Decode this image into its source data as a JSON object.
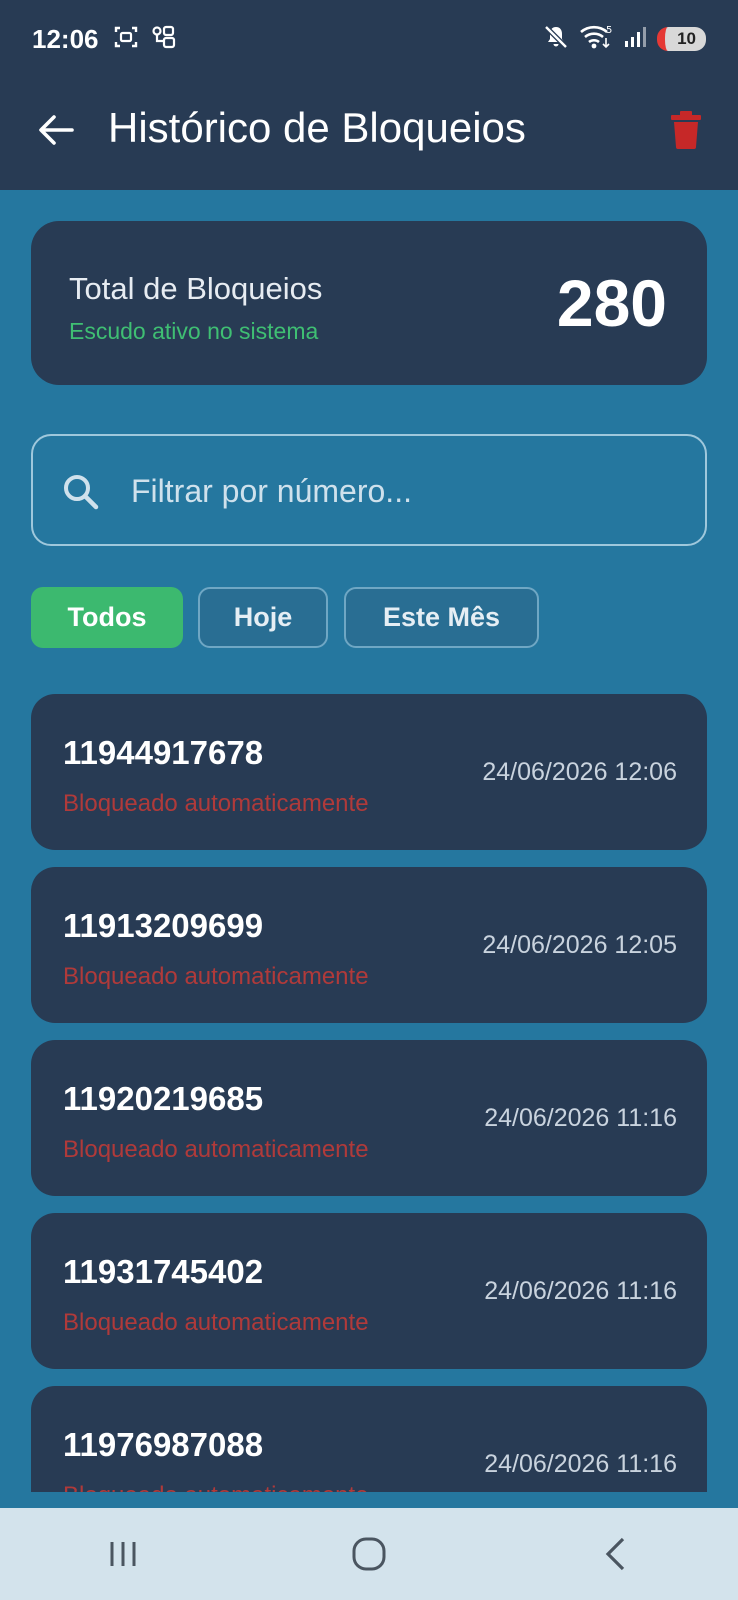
{
  "status_bar": {
    "time": "12:06",
    "battery": "10",
    "icons": [
      "screenshot-icon",
      "cast-icon",
      "mute-icon",
      "wifi-icon",
      "signal-icon",
      "battery-icon"
    ]
  },
  "app_bar": {
    "title": "Histórico de Bloqueios"
  },
  "summary": {
    "title": "Total de Bloqueios",
    "subtitle": "Escudo ativo no sistema",
    "count": "280"
  },
  "search": {
    "placeholder": "Filtrar por número..."
  },
  "filters": [
    {
      "label": "Todos",
      "active": true
    },
    {
      "label": "Hoje",
      "active": false
    },
    {
      "label": "Este Mês",
      "active": false
    }
  ],
  "blocks": [
    {
      "number": "11944917678",
      "status": "Bloqueado automaticamente",
      "time": "24/06/2026 12:06"
    },
    {
      "number": "11913209699",
      "status": "Bloqueado automaticamente",
      "time": "24/06/2026 12:05"
    },
    {
      "number": "11920219685",
      "status": "Bloqueado automaticamente",
      "time": "24/06/2026 11:16"
    },
    {
      "number": "11931745402",
      "status": "Bloqueado automaticamente",
      "time": "24/06/2026 11:16"
    },
    {
      "number": "11976987088",
      "status": "Bloqueado automaticamente",
      "time": "24/06/2026 11:16"
    }
  ],
  "colors": {
    "background": "#25779f",
    "card": "#283b54",
    "accent_green": "#3cb96f",
    "status_red": "#b03a3a",
    "delete_red": "#c62828"
  }
}
